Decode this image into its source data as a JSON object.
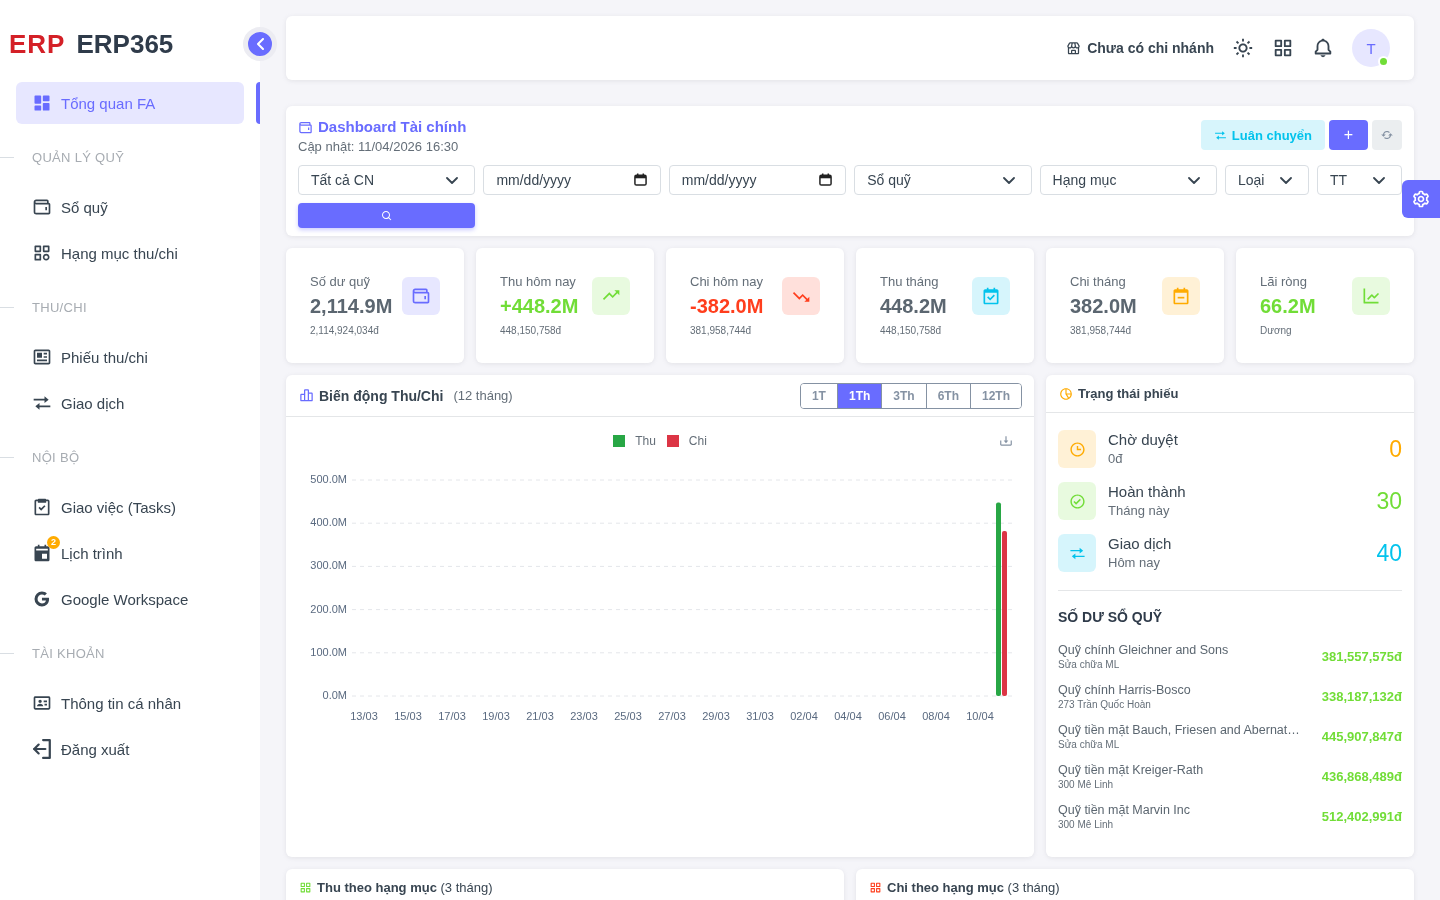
{
  "sidebar": {
    "logo": "ERP",
    "brand": "ERP365",
    "groups": [
      {
        "items": [
          {
            "label": "Tổng quan FA",
            "selected": true
          }
        ]
      },
      {
        "title": "QUẢN LÝ QUỸ",
        "items": [
          {
            "label": "Sổ quỹ",
            "selected": false
          },
          {
            "label": "Hạng mục thu/chi",
            "selected": false
          }
        ]
      },
      {
        "title": "THU/CHI",
        "items": [
          {
            "label": "Phiếu thu/chi",
            "selected": false
          },
          {
            "label": "Giao dịch",
            "selected": false
          }
        ]
      },
      {
        "title": "NỘI BỘ",
        "items": [
          {
            "label": "Giao việc (Tasks)",
            "selected": false
          },
          {
            "label": "Lịch trình",
            "selected": false,
            "badge": "2"
          },
          {
            "label": "Google Workspace",
            "selected": false
          }
        ]
      },
      {
        "title": "TÀI KHOẢN",
        "items": [
          {
            "label": "Thông tin cá nhân",
            "selected": false
          },
          {
            "label": "Đăng xuất",
            "selected": false
          }
        ]
      }
    ]
  },
  "top_bar": {
    "branch": "Chưa có chi nhánh",
    "avatar": {
      "initial": "T",
      "online": true
    }
  },
  "dashboard": {
    "title": "Dashboard Tài chính",
    "updated": "Cập nhật: 11/04/2026 16:30",
    "actions": [
      {
        "kind": "transfer",
        "label": "Luân chuyển"
      },
      {
        "kind": "add",
        "label": "+"
      },
      {
        "kind": "refresh"
      }
    ],
    "filters": [
      {
        "kind": "select",
        "value": "Tất cả CN"
      },
      {
        "kind": "date",
        "placeholder": "mm/dd/yyyy"
      },
      {
        "kind": "date",
        "placeholder": "mm/dd/yyyy"
      },
      {
        "kind": "select",
        "value": "Sổ quỹ"
      },
      {
        "kind": "select",
        "value": "Hạng mục"
      },
      {
        "kind": "select",
        "value": "Loại"
      },
      {
        "kind": "select",
        "value": "TT"
      }
    ]
  },
  "kpis": [
    {
      "label": "Số dư quỹ",
      "value": "2,114.9M",
      "detail": "2,114,924,034đ",
      "positive": false,
      "negative": false,
      "color": "#696cff"
    },
    {
      "label": "Thu hôm nay",
      "value": "+448.2M",
      "detail": "448,150,758đ",
      "positive": true,
      "negative": false,
      "color": "#71dd37"
    },
    {
      "label": "Chi hôm nay",
      "value": "-382.0M",
      "detail": "381,958,744đ",
      "positive": false,
      "negative": true,
      "color": "#ff3e1d"
    },
    {
      "label": "Thu tháng",
      "value": "448.2M",
      "detail": "448,150,758đ",
      "positive": false,
      "negative": false,
      "color": "#03c3ec"
    },
    {
      "label": "Chi tháng",
      "value": "382.0M",
      "detail": "381,958,744đ",
      "positive": false,
      "negative": false,
      "color": "#ffab00"
    },
    {
      "label": "Lãi ròng",
      "value": "66.2M",
      "detail": "Dương",
      "positive": true,
      "negative": false,
      "color": "#71dd37"
    }
  ],
  "trend_chart": {
    "title": "Biến động Thu/Chi",
    "period": "(12 tháng)",
    "ranges": [
      {
        "label": "1T",
        "selected": false
      },
      {
        "label": "1Th",
        "selected": true
      },
      {
        "label": "3Th",
        "selected": false
      },
      {
        "label": "6Th",
        "selected": false
      },
      {
        "label": "12Th",
        "selected": false
      }
    ],
    "chart_data": {
      "type": "bar",
      "categories": [
        "13/03",
        null,
        "15/03",
        null,
        "17/03",
        null,
        "19/03",
        null,
        "21/03",
        null,
        "23/03",
        null,
        "25/03",
        null,
        "27/03",
        null,
        "29/03",
        null,
        "31/03",
        null,
        "02/04",
        null,
        "04/04",
        null,
        "06/04",
        null,
        "08/04",
        null,
        "10/04",
        null
      ],
      "ylim": [
        0,
        500
      ],
      "yticks": [
        {
          "value": 0,
          "label": "0.0M"
        },
        {
          "value": 100,
          "label": "100.0M"
        },
        {
          "value": 200,
          "label": "200.0M"
        },
        {
          "value": 300,
          "label": "300.0M"
        },
        {
          "value": 400,
          "label": "400.0M"
        },
        {
          "value": 500,
          "label": "500.0M"
        }
      ],
      "grid": true,
      "legend": "top",
      "series": [
        {
          "name": "Thu",
          "color": "#28a745",
          "values": [
            0,
            0,
            0,
            0,
            0,
            0,
            0,
            0,
            0,
            0,
            0,
            0,
            0,
            0,
            0,
            0,
            0,
            0,
            0,
            0,
            0,
            0,
            0,
            0,
            0,
            0,
            0,
            0,
            0,
            448
          ]
        },
        {
          "name": "Chi",
          "color": "#dc3545",
          "values": [
            0,
            0,
            0,
            0,
            0,
            0,
            0,
            0,
            0,
            0,
            0,
            0,
            0,
            0,
            0,
            0,
            0,
            0,
            0,
            0,
            0,
            0,
            0,
            0,
            0,
            0,
            0,
            0,
            0,
            382
          ]
        }
      ]
    }
  },
  "status_panel": {
    "title": "Trạng thái phiếu",
    "statuses": [
      {
        "label": "Chờ duyệt",
        "detail": "0đ",
        "count": "0",
        "color": "#ffab00"
      },
      {
        "label": "Hoàn thành",
        "detail": "Tháng này",
        "count": "30",
        "color": "#71dd37"
      },
      {
        "label": "Giao dịch",
        "detail": "Hôm nay",
        "count": "40",
        "color": "#03c3ec"
      }
    ],
    "balances_title": "SỐ DƯ SỔ QUỸ",
    "balances": [
      {
        "name": "Quỹ chính Gleichner and Sons",
        "note": "Sửa chữa ML",
        "amount": "381,557,575đ"
      },
      {
        "name": "Quỹ chính Harris-Bosco",
        "note": "273 Trần Quốc Hoàn",
        "amount": "338,187,132đ"
      },
      {
        "name": "Quỹ tiền mặt Bauch, Friesen and Abernat…",
        "note": "Sửa chữa ML",
        "amount": "445,907,847đ"
      },
      {
        "name": "Quỹ tiền mặt Kreiger-Rath",
        "note": "300 Mê Linh",
        "amount": "436,868,489đ"
      },
      {
        "name": "Quỹ tiền mặt Marvin Inc",
        "note": "300 Mê Linh",
        "amount": "512,402,991đ"
      }
    ]
  },
  "category_cards": [
    {
      "title": "**Thu theo hạng mục** (3 tháng)",
      "color": "#71dd37"
    },
    {
      "title": "**Chi theo hạng mục** (3 tháng)",
      "color": "#ff3e1d"
    }
  ]
}
